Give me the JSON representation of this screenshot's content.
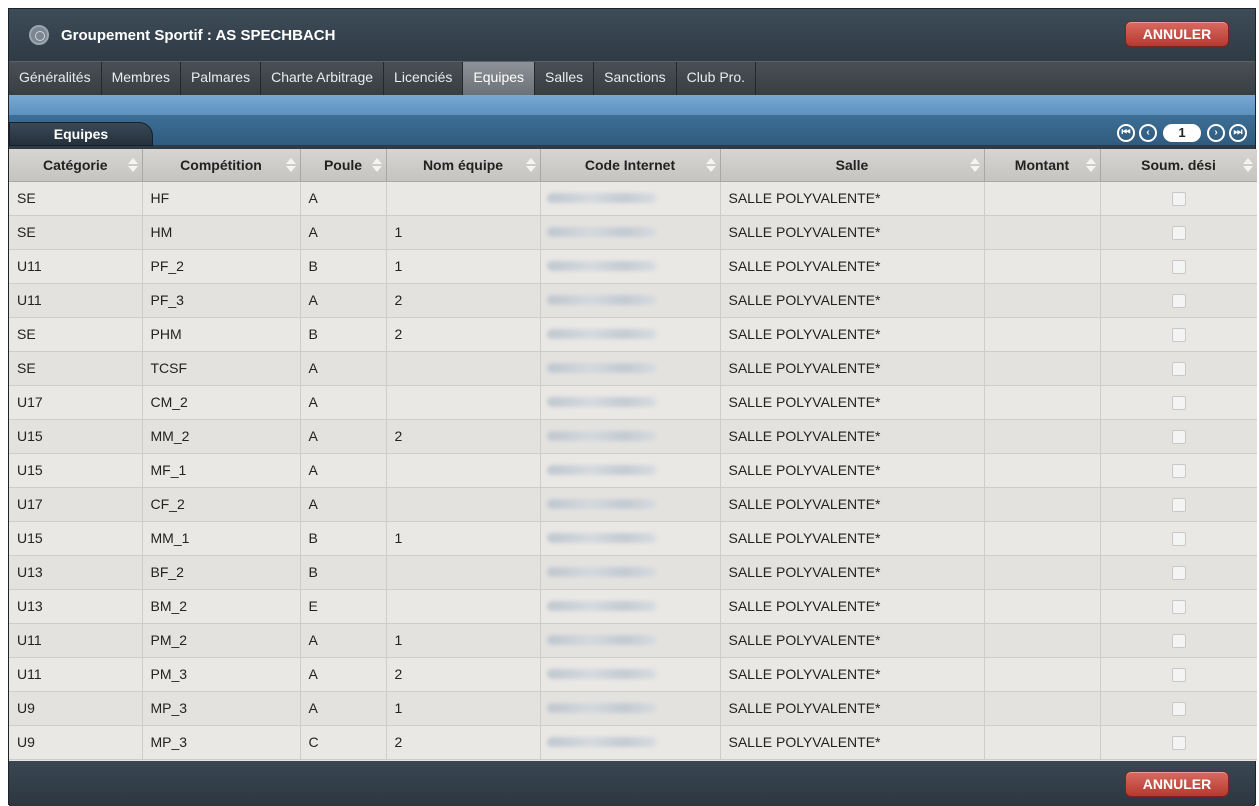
{
  "window": {
    "title": "Groupement Sportif : AS SPECHBACH",
    "cancel_label": "ANNULER",
    "colors": {
      "cancel_button": "#c4473c",
      "title_bar": "#35424d",
      "active_tab": "#7d8388",
      "header_strip": "#5d91bf"
    }
  },
  "tabs": [
    {
      "label": "Généralités"
    },
    {
      "label": "Membres"
    },
    {
      "label": "Palmares"
    },
    {
      "label": "Charte Arbitrage"
    },
    {
      "label": "Licenciés"
    },
    {
      "label": "Equipes",
      "active": true
    },
    {
      "label": "Salles"
    },
    {
      "label": "Sanctions"
    },
    {
      "label": "Club Pro."
    }
  ],
  "section": {
    "title": "Equipes"
  },
  "pager": {
    "current_page": "1",
    "icons": [
      "first-page-icon",
      "prev-page-icon",
      "next-page-icon",
      "last-page-icon"
    ]
  },
  "table": {
    "columns": [
      "Catégorie",
      "Compétition",
      "Poule",
      "Nom équipe",
      "Code Internet",
      "Salle",
      "Montant",
      "Soum. dési"
    ],
    "rows": [
      {
        "categorie": "SE",
        "competition": "HF",
        "poule": "A",
        "nom": "",
        "salle": "SALLE POLYVALENTE*"
      },
      {
        "categorie": "SE",
        "competition": "HM",
        "poule": "A",
        "nom": "1",
        "salle": "SALLE POLYVALENTE*"
      },
      {
        "categorie": "U11",
        "competition": "PF_2",
        "poule": "B",
        "nom": "1",
        "salle": "SALLE POLYVALENTE*"
      },
      {
        "categorie": "U11",
        "competition": "PF_3",
        "poule": "A",
        "nom": "2",
        "salle": "SALLE POLYVALENTE*"
      },
      {
        "categorie": "SE",
        "competition": "PHM",
        "poule": "B",
        "nom": "2",
        "salle": "SALLE POLYVALENTE*"
      },
      {
        "categorie": "SE",
        "competition": "TCSF",
        "poule": "A",
        "nom": "",
        "salle": "SALLE POLYVALENTE*"
      },
      {
        "categorie": "U17",
        "competition": "CM_2",
        "poule": "A",
        "nom": "",
        "salle": "SALLE POLYVALENTE*"
      },
      {
        "categorie": "U15",
        "competition": "MM_2",
        "poule": "A",
        "nom": "2",
        "salle": "SALLE POLYVALENTE*"
      },
      {
        "categorie": "U15",
        "competition": "MF_1",
        "poule": "A",
        "nom": "",
        "salle": "SALLE POLYVALENTE*"
      },
      {
        "categorie": "U17",
        "competition": "CF_2",
        "poule": "A",
        "nom": "",
        "salle": "SALLE POLYVALENTE*"
      },
      {
        "categorie": "U15",
        "competition": "MM_1",
        "poule": "B",
        "nom": "1",
        "salle": "SALLE POLYVALENTE*"
      },
      {
        "categorie": "U13",
        "competition": "BF_2",
        "poule": "B",
        "nom": "",
        "salle": "SALLE POLYVALENTE*"
      },
      {
        "categorie": "U13",
        "competition": "BM_2",
        "poule": "E",
        "nom": "",
        "salle": "SALLE POLYVALENTE*"
      },
      {
        "categorie": "U11",
        "competition": "PM_2",
        "poule": "A",
        "nom": "1",
        "salle": "SALLE POLYVALENTE*"
      },
      {
        "categorie": "U11",
        "competition": "PM_3",
        "poule": "A",
        "nom": "2",
        "salle": "SALLE POLYVALENTE*"
      },
      {
        "categorie": "U9",
        "competition": "MP_3",
        "poule": "A",
        "nom": "1",
        "salle": "SALLE POLYVALENTE*"
      },
      {
        "categorie": "U9",
        "competition": "MP_3",
        "poule": "C",
        "nom": "2",
        "salle": "SALLE POLYVALENTE*"
      }
    ]
  }
}
